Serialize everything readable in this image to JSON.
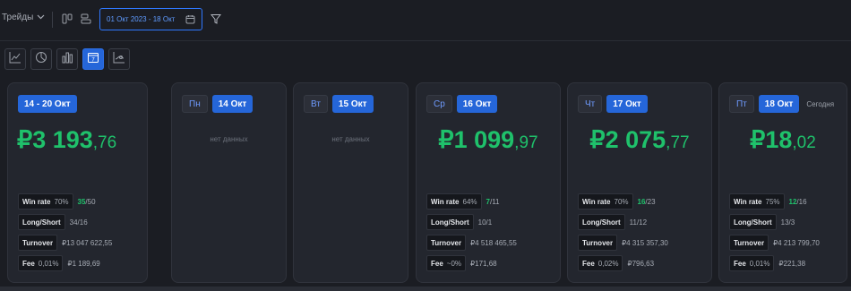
{
  "toolbar": {
    "trades_label": "Трейды",
    "date_range": "01 Окт 2023 - 18 Окт"
  },
  "icons": {
    "trades_dropdown": "chevron-down-icon",
    "layout_columns": "columns-icon",
    "layout_rows": "rows-icon",
    "calendar": "calendar-icon",
    "filter": "filter-icon",
    "view_line": "line-chart-icon",
    "view_pie": "pie-chart-icon",
    "view_bar": "bar-chart-icon",
    "view_calendar": "calendar-view-icon",
    "view_area": "trend-chart-icon"
  },
  "views": {
    "calendar_day": "7"
  },
  "colors": {
    "accent": "#2566d9",
    "profit": "#1fc16b",
    "background": "#1b1d23",
    "card": "#23262e"
  },
  "week": {
    "range": "14 - 20 Окт",
    "currency": "₽",
    "amount_int": "3 193",
    "amount_dec": ",76",
    "winrate_pct": "70%",
    "winrate_wins": "35",
    "winrate_total": "/50",
    "longshort": "34/16",
    "turnover": "₽13 047 622,55",
    "fee_pct": "0,01%",
    "fee": "₽1 189,69"
  },
  "labels": {
    "winrate": "Win rate",
    "longshort": "Long/Short",
    "turnover": "Turnover",
    "fee": "Fee",
    "nodata": "нет данных",
    "today": "Сегодня"
  },
  "days": [
    {
      "weekday": "Пн",
      "date": "14 Окт",
      "has_data": false
    },
    {
      "weekday": "Вт",
      "date": "15 Окт",
      "has_data": false
    },
    {
      "weekday": "Ср",
      "date": "16 Окт",
      "has_data": true,
      "currency": "₽",
      "amount_int": "1 099",
      "amount_dec": ",97",
      "winrate_pct": "64%",
      "winrate_wins": "7",
      "winrate_total": "/11",
      "longshort": "10/1",
      "turnover": "₽4 518 465,55",
      "fee_pct": "~0%",
      "fee": "₽171,68"
    },
    {
      "weekday": "Чт",
      "date": "17 Окт",
      "has_data": true,
      "currency": "₽",
      "amount_int": "2 075",
      "amount_dec": ",77",
      "winrate_pct": "70%",
      "winrate_wins": "16",
      "winrate_total": "/23",
      "longshort": "11/12",
      "turnover": "₽4 315 357,30",
      "fee_pct": "0,02%",
      "fee": "₽796,63"
    },
    {
      "weekday": "Пт",
      "date": "18 Окт",
      "has_data": true,
      "today": true,
      "currency": "₽",
      "amount_int": "18",
      "amount_dec": ",02",
      "winrate_pct": "75%",
      "winrate_wins": "12",
      "winrate_total": "/16",
      "longshort": "13/3",
      "turnover": "₽4 213 799,70",
      "fee_pct": "0,01%",
      "fee": "₽221,38"
    }
  ]
}
